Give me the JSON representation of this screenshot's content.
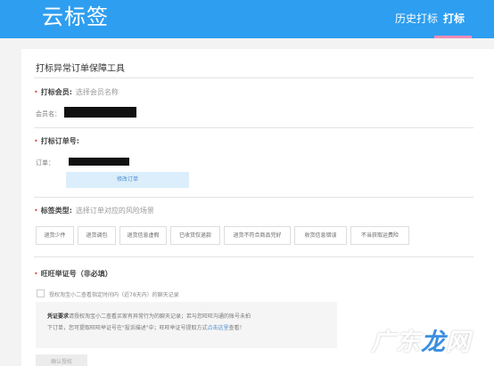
{
  "header": {
    "logo": "云标签",
    "nav": {
      "history": "历史打标",
      "print": "打标"
    }
  },
  "page": {
    "title": "打标异常订单保障工具"
  },
  "member_section": {
    "label": "打标会员:",
    "hint": "选择会员名称",
    "member_field_label": "会员名："
  },
  "order_section": {
    "label": "打标订单号:",
    "order_field_label": "订单：",
    "edit_button": "修改订单"
  },
  "tag_section": {
    "label": "标签类型:",
    "hint": "选择订单对应的风险场景",
    "tags": [
      "退货少件",
      "退货调包",
      "退货信息虚假",
      "已收货仅退款",
      "退货不符合商品完好",
      "收货信息错误",
      "不当获取运费险"
    ]
  },
  "wangwang_section": {
    "label": "旺旺举证号（非必填）",
    "checkbox_label": "授权淘宝小二查看指定时间内（近78天内）的聊天记录",
    "info": {
      "strong": "凭证要求",
      "text1": "请授权淘宝小二查看买家有异常行为的聊天记录；若与您旺旺沟通的账号未拍",
      "text2": "下订单，您可提取旺旺举证号在\"投诉描述\"中；旺旺举证号提取方式",
      "link": "点击这里",
      "text3": "查看！"
    },
    "confirm_button": "确认授权"
  },
  "watermark": {
    "text": "广东龙网"
  },
  "colors": {
    "header_blue": "#2e9ef0",
    "required_red": "#e04a4a",
    "link_blue": "#4a8fd0",
    "nav_underline": "#f08cb8"
  }
}
